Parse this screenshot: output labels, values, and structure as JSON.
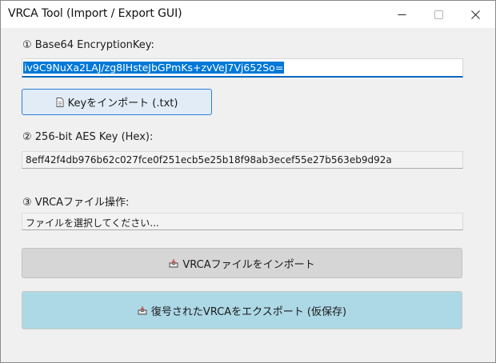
{
  "window": {
    "title": "VRCA Tool (Import / Export GUI)"
  },
  "section1": {
    "label": "① Base64 EncryptionKey:",
    "key_value": "iv9C9NuXa2LAJ/zg8IHsteJbGPmKs+zvVeJ7Vj652So=",
    "import_key_button": "Keyをインポート (.txt)"
  },
  "section2": {
    "label": "② 256-bit AES Key (Hex):",
    "hex_value": "8eff42f4db976b62c027fce0f251ecb5e25b18f98ab3ecef55e27b563eb9d92a"
  },
  "section3": {
    "label": "③ VRCAファイル操作:",
    "file_status": "ファイルを選択してください...",
    "import_vrca_button": "VRCAファイルをインポート",
    "export_button": "復号されたVRCAをエクスポート (仮保存)"
  },
  "icons": {
    "key_button_icon": "document-icon",
    "import_vrca_icon": "inbox-icon",
    "export_icon": "inbox-icon"
  },
  "colors": {
    "accent_blue": "#0067c0",
    "selection_blue": "#0078d7",
    "key_button_bg": "#e1ecf7",
    "export_button_bg": "#add8e6",
    "import_button_bg": "#d6d6d6"
  }
}
